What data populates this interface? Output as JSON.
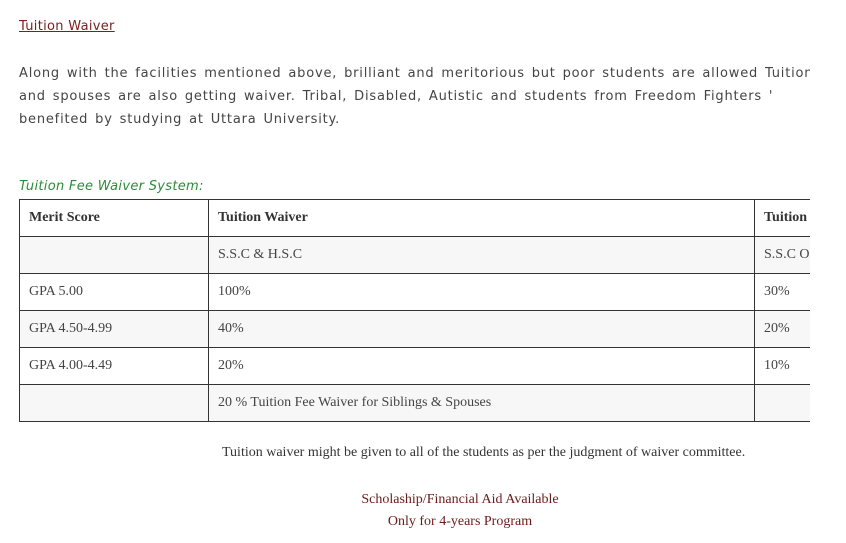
{
  "section": {
    "title": "Tuition Waiver"
  },
  "intro": {
    "lines": [
      "Along with the facilities mentioned above, brilliant and meritorious but poor students are allowed Tuition F",
      "and spouses are also getting waiver. Tribal, Disabled, Autistic and students from Freedom Fighters '",
      "benefited by studying at Uttara University."
    ]
  },
  "waiver_system": {
    "heading": "Tuition Fee Waiver System:",
    "table": {
      "header": [
        "Merit Score",
        "Tuition Waiver",
        "Tuition"
      ],
      "rows": [
        [
          "",
          "S.S.C & H.S.C",
          "S.S.C O"
        ],
        [
          "GPA 5.00",
          "100%",
          "30%"
        ],
        [
          "GPA 4.50-4.99",
          "40%",
          "20%"
        ],
        [
          "GPA 4.00-4.49",
          "20%",
          "10%"
        ],
        [
          "",
          "20 % Tuition Fee Waiver for Siblings & Spouses",
          ""
        ]
      ]
    }
  },
  "note": "Tuition waiver might be given to all of the students as per the judgment of waiver committee.",
  "aid": {
    "line1": "Scholaship/Financial Aid Available",
    "line2": "Only for 4-years Program"
  },
  "colors": {
    "title": "#7a1f1f",
    "subheading": "#2e8b3a",
    "aid_text": "#6b1a1a",
    "table_border": "#333333"
  }
}
